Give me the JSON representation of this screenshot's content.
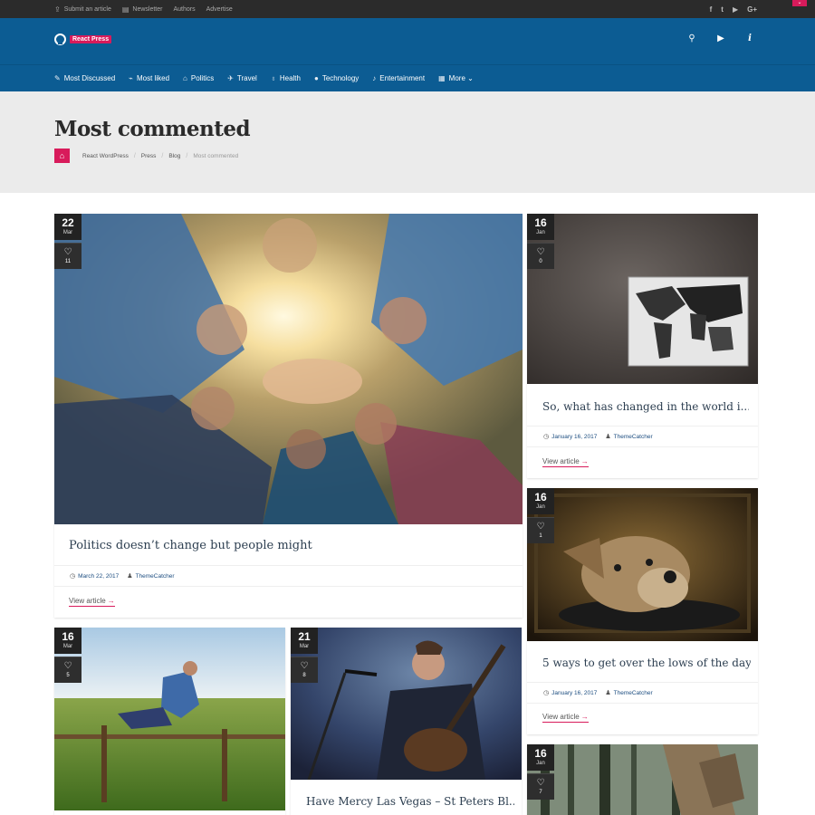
{
  "topbar": {
    "links": [
      {
        "icon": "upload-icon",
        "glyph": "⇪",
        "label": "Submit an article"
      },
      {
        "icon": "newsletter-icon",
        "glyph": "▤",
        "label": "Newsletter"
      },
      {
        "icon": "",
        "glyph": "",
        "label": "Authors"
      },
      {
        "icon": "",
        "glyph": "",
        "label": "Advertise"
      }
    ],
    "social": [
      {
        "icon": "facebook-icon",
        "glyph": "f"
      },
      {
        "icon": "twitter-icon",
        "glyph": "t"
      },
      {
        "icon": "youtube-icon",
        "glyph": "▶"
      },
      {
        "icon": "google-plus-icon",
        "glyph": "G+"
      }
    ],
    "corner_glyph": "⌄"
  },
  "header": {
    "logo_text": "React Press",
    "icons": [
      {
        "icon": "search-icon",
        "glyph": "⚲"
      },
      {
        "icon": "play-icon",
        "glyph": "▶"
      },
      {
        "icon": "info-icon",
        "glyph": "i"
      }
    ]
  },
  "nav": {
    "items": [
      {
        "icon": "comments-icon",
        "glyph": "✎",
        "label": "Most Discussed"
      },
      {
        "icon": "chart-icon",
        "glyph": "⌁",
        "label": "Most liked"
      },
      {
        "icon": "bank-icon",
        "glyph": "⌂",
        "label": "Politics"
      },
      {
        "icon": "plane-icon",
        "glyph": "✈",
        "label": "Travel"
      },
      {
        "icon": "stethoscope-icon",
        "glyph": "♁",
        "label": "Health"
      },
      {
        "icon": "apple-icon",
        "glyph": "●",
        "label": "Technology"
      },
      {
        "icon": "microphone-icon",
        "glyph": "♪",
        "label": "Entertainment"
      },
      {
        "icon": "grid-icon",
        "glyph": "▦",
        "label": "More ⌄"
      }
    ]
  },
  "page": {
    "title": "Most commented",
    "home_glyph": "⌂",
    "breadcrumb": [
      "React WordPress",
      "Press",
      "Blog"
    ],
    "breadcrumb_current": "Most commented",
    "sep": "/"
  },
  "common": {
    "heart": "♡",
    "view_article": "View article",
    "arrow": "→",
    "clock": "◷",
    "user": "♟"
  },
  "posts": [
    {
      "day": "22",
      "month": "Mar",
      "likes": "11",
      "title": "Politics doesn’t change but people might",
      "date": "March 22, 2017",
      "author": "ThemeCatcher",
      "image": "group-hands-photo"
    },
    {
      "day": "16",
      "month": "Jan",
      "likes": "0",
      "title": "So, what has changed in the world i...",
      "date": "January 16, 2017",
      "author": "ThemeCatcher",
      "image": "world-map-canvas-photo"
    },
    {
      "day": "16",
      "month": "Jan",
      "likes": "1",
      "title": "5 ways to get over the lows of the day",
      "date": "January 16, 2017",
      "author": "ThemeCatcher",
      "image": "dog-photo"
    },
    {
      "day": "16",
      "month": "Mar",
      "likes": "5",
      "title": "",
      "date": "",
      "author": "",
      "image": "fence-jump-photo"
    },
    {
      "day": "21",
      "month": "Mar",
      "likes": "8",
      "title": "Have Mercy Las Vegas – St Peters Bl...",
      "date": "",
      "author": "",
      "image": "guitarist-photo"
    },
    {
      "day": "16",
      "month": "Jan",
      "likes": "7",
      "title": "",
      "date": "",
      "author": "",
      "image": "forest-hiker-photo"
    }
  ]
}
